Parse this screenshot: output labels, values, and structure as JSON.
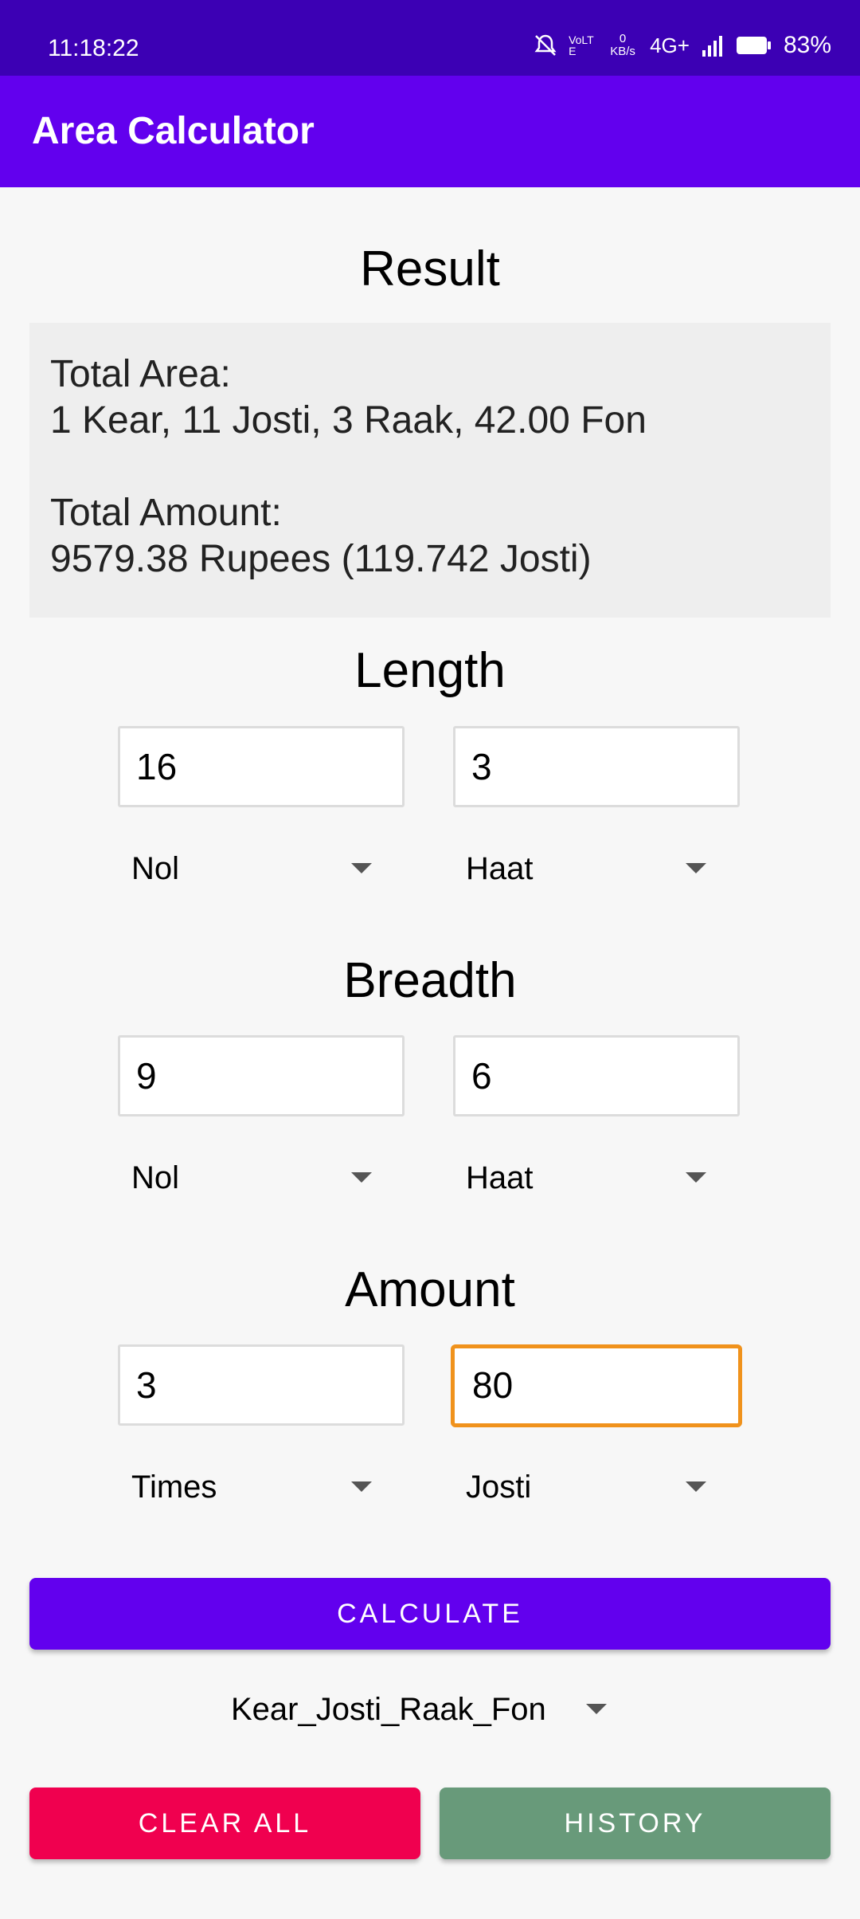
{
  "status_bar": {
    "time": "11:18:22",
    "network_speed": "0 KB/s",
    "network_type": "4G+",
    "volte": "VoLTE",
    "battery_percent": "83%",
    "icons": [
      "mute-bell-icon",
      "volte-icon",
      "signal-icon",
      "battery-icon"
    ]
  },
  "app_bar": {
    "title": "Area Calculator"
  },
  "result": {
    "heading": "Result",
    "total_area_label": "Total Area:",
    "total_area_value": "1 Kear, 11 Josti, 3 Raak, 42.00 Fon",
    "total_amount_label": "Total Amount:",
    "total_amount_value": "9579.38 Rupees (119.742 Josti)"
  },
  "length": {
    "heading": "Length",
    "value1": "16",
    "value2": "3",
    "unit1": "Nol",
    "unit2": "Haat"
  },
  "breadth": {
    "heading": "Breadth",
    "value1": "9",
    "value2": "6",
    "unit1": "Nol",
    "unit2": "Haat"
  },
  "amount": {
    "heading": "Amount",
    "value1": "3",
    "value2": "80",
    "unit1": "Times",
    "unit2": "Josti"
  },
  "buttons": {
    "calculate": "CALCULATE",
    "clear_all": "CLEAR ALL",
    "history": "HISTORY"
  },
  "output_format": {
    "selected": "Kear_Josti_Raak_Fon"
  },
  "colors": {
    "status_bar": "#3c00b4",
    "app_bar": "#6200ee",
    "calculate_button": "#6200ee",
    "clear_all_button": "#f0004f",
    "history_button": "#689a7a",
    "focused_border": "#f0921c"
  }
}
